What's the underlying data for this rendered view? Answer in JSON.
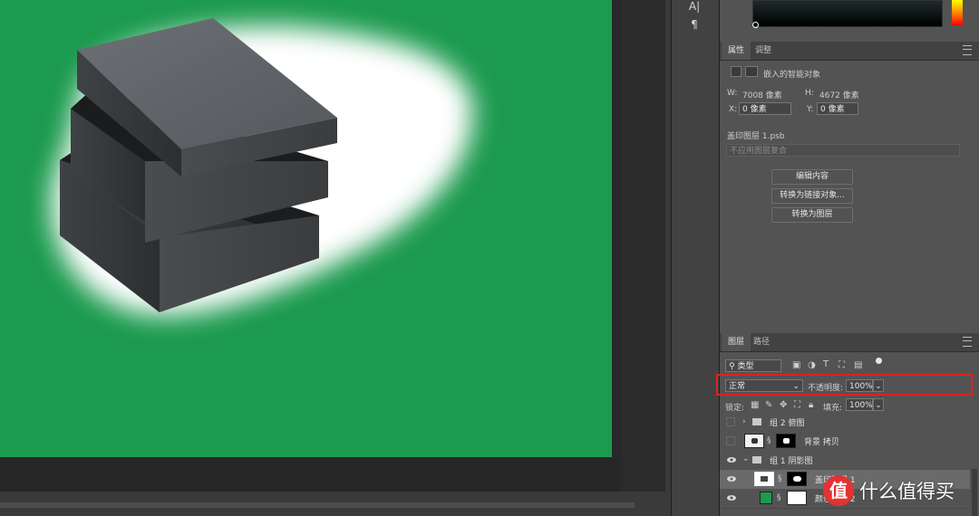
{
  "colors": {
    "canvas_green": "#1c9a4f",
    "highlight_red": "#e02020",
    "panel_bg": "#535353",
    "app_bg": "#282828"
  },
  "tool_strip": {
    "items": [
      {
        "glyph": "A|",
        "icon": "character-panel-icon"
      },
      {
        "glyph": "¶",
        "icon": "paragraph-panel-icon"
      }
    ]
  },
  "properties": {
    "tabs": [
      "属性",
      "调整"
    ],
    "active_tab": "属性",
    "object_type": "嵌入的智能对象",
    "w_label": "W:",
    "w_value": "7008 像素",
    "h_label": "H:",
    "h_value": "4672 像素",
    "x_label": "X:",
    "x_value": "0 像素",
    "y_label": "Y:",
    "y_value": "0 像素",
    "file_name": "盖印图层 1.psb",
    "comp_placeholder": "不应用图层复合",
    "buttons": [
      "编辑内容",
      "转换为链接对象...",
      "转换为图层"
    ]
  },
  "layers": {
    "tabs": [
      "图层",
      "路径"
    ],
    "active_tab": "图层",
    "filter_label": "类型",
    "blend_mode": "正常",
    "opacity_label": "不透明度:",
    "opacity_value": "100%",
    "lock_label": "锁定:",
    "fill_label": "填充:",
    "fill_value": "100%",
    "rows": [
      {
        "name": "组 2 俯图",
        "kind": "group",
        "visible": false,
        "expanded": false
      },
      {
        "name": "背景 拷贝",
        "kind": "layer",
        "visible": false
      },
      {
        "name": "组 1 阴影图",
        "kind": "group",
        "visible": true,
        "expanded": true
      },
      {
        "name": "盖印图层 1",
        "kind": "smart-object",
        "visible": true,
        "selected": true
      },
      {
        "name": "颜色填充 2",
        "kind": "fill",
        "visible": true
      }
    ]
  },
  "annotation": {
    "mark": "✕"
  },
  "watermark": {
    "logo_text": "值",
    "text": "什么值得买"
  }
}
